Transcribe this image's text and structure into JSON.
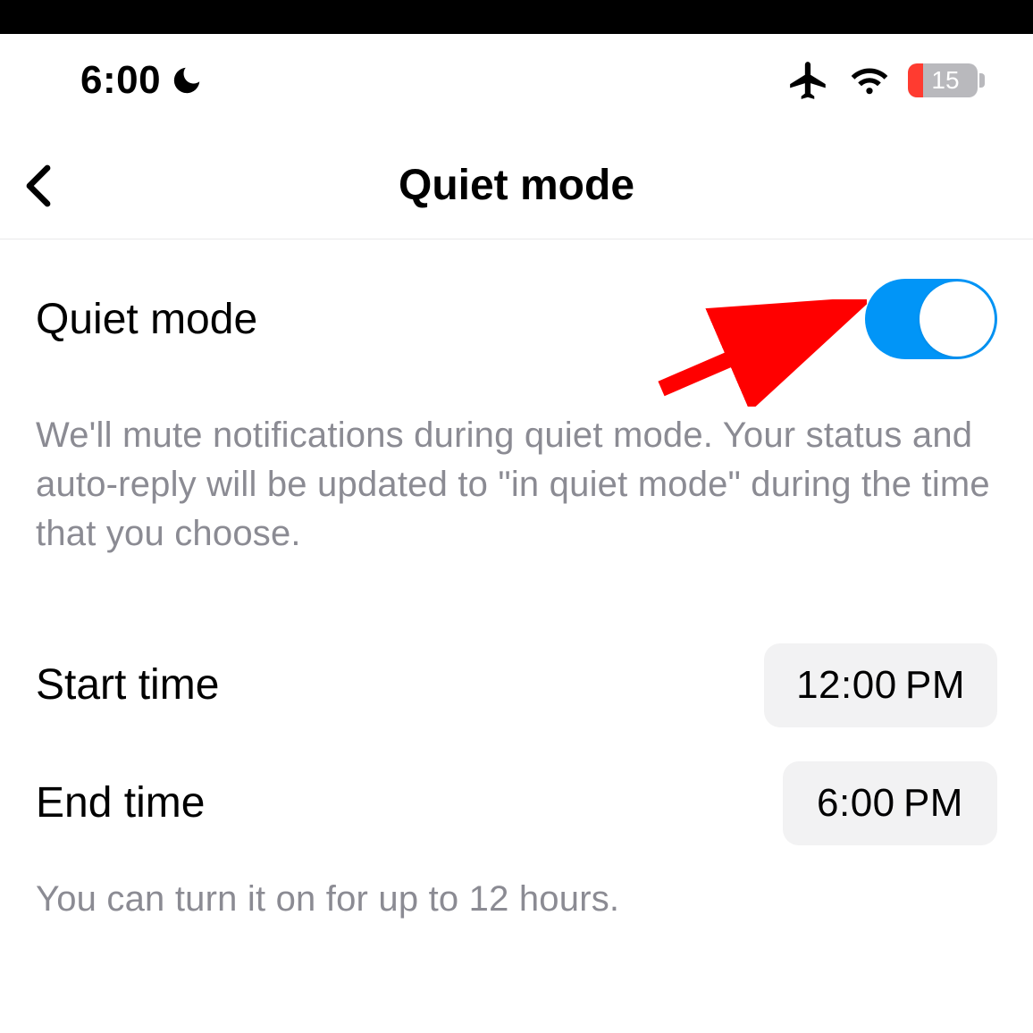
{
  "status_bar": {
    "time": "6:00",
    "battery_percent": "15"
  },
  "nav": {
    "title": "Quiet mode"
  },
  "quiet_mode": {
    "label": "Quiet mode",
    "enabled": true,
    "description": "We'll mute notifications during quiet mode. Your status and auto-reply will be updated to \"in quiet mode\" during the time that you choose."
  },
  "times": {
    "start_label": "Start time",
    "start_value": "12:00 PM",
    "end_label": "End time",
    "end_value": "6:00 PM"
  },
  "footnote": "You can turn it on for up to 12 hours."
}
